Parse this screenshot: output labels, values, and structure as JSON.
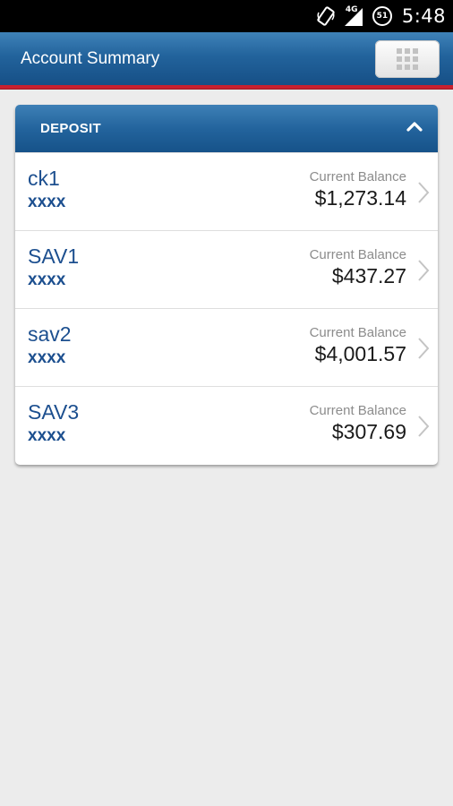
{
  "status_bar": {
    "network_label": "4G",
    "battery_level": "51",
    "time": "5:48",
    "icons": [
      "screen-rotate-icon",
      "signal-icon",
      "battery-icon"
    ]
  },
  "action_bar": {
    "title": "Account Summary",
    "menu_button_icon": "grid-menu-icon"
  },
  "colors": {
    "brand_blue": "#22639c",
    "accent_red": "#c8202f",
    "account_name": "#1c4f8f",
    "balance_label": "#8c8c8c",
    "background": "#ececec"
  },
  "deposit_section": {
    "header": "DEPOSIT",
    "collapse_icon": "chevron-up-icon",
    "accounts": [
      {
        "name": "ck1",
        "number": "xxxx",
        "balance_label": "Current Balance",
        "balance": "$1,273.14"
      },
      {
        "name": "SAV1",
        "number": "xxxx",
        "balance_label": "Current Balance",
        "balance": "$437.27"
      },
      {
        "name": "sav2",
        "number": "xxxx",
        "balance_label": "Current Balance",
        "balance": "$4,001.57"
      },
      {
        "name": "SAV3",
        "number": "xxxx",
        "balance_label": "Current Balance",
        "balance": "$307.69"
      }
    ]
  }
}
